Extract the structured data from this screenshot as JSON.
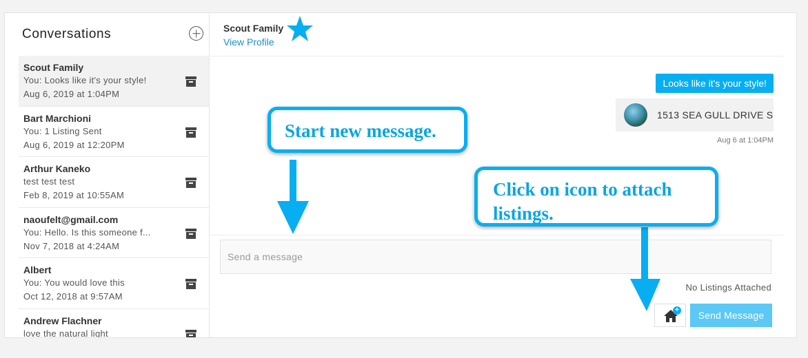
{
  "sidebar": {
    "title": "Conversations",
    "conversations": [
      {
        "name": "Scout Family",
        "preview": "You: Looks like it's your style!",
        "date": "Aug 6, 2019 at 1:04PM"
      },
      {
        "name": "Bart Marchioni",
        "preview": "You: 1 Listing Sent",
        "date": "Aug 6, 2019 at 12:20PM"
      },
      {
        "name": "Arthur Kaneko",
        "preview": "test test test",
        "date": "Feb 8, 2019 at 10:55AM"
      },
      {
        "name": "naoufelt@gmail.com",
        "preview": "You: Hello. Is this someone f...",
        "date": "Nov 7, 2018 at 4:24AM"
      },
      {
        "name": "Albert",
        "preview": "You: You would love this",
        "date": "Oct 12, 2018 at 9:57AM"
      },
      {
        "name": "Andrew Flachner",
        "preview": "love the natural light",
        "date": ""
      }
    ]
  },
  "header": {
    "contact_name": "Scout Family",
    "profile_link": "View Profile"
  },
  "thread": {
    "message_text": "Looks like it's your style!",
    "listing_address": "1513 SEA GULL DRIVE S",
    "message_time": "Aug 6 at 1:04PM"
  },
  "composer": {
    "placeholder": "Send a message",
    "listings_status": "No Listings Attached",
    "attach_plus": "+",
    "send_label": "Send Message"
  },
  "callouts": {
    "start_message": "Start new message.",
    "attach_listings": "Click on icon to attach listings."
  },
  "colors": {
    "accent": "#08aef2",
    "link": "#1a8fd1",
    "send_button": "#5bc8f5"
  },
  "icons": [
    "plus-circle-icon",
    "archive-icon",
    "star-icon",
    "home-icon",
    "arrow-down-icon"
  ]
}
